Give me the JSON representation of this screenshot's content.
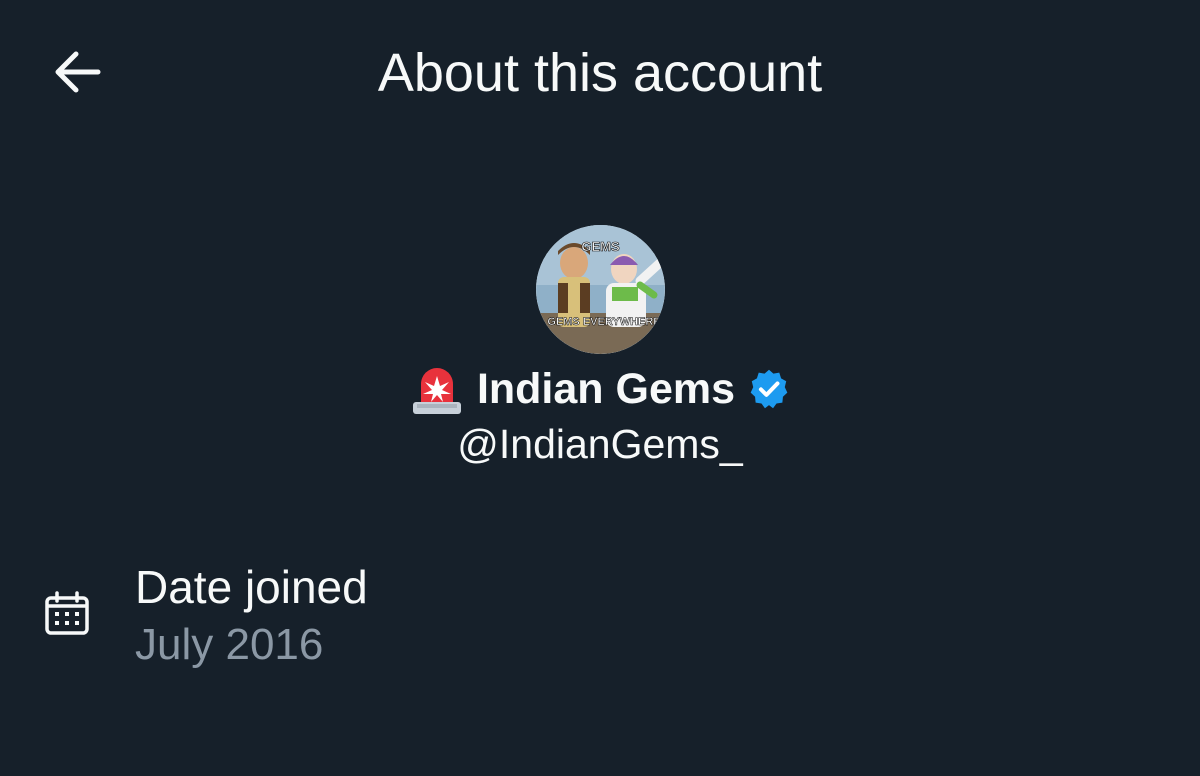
{
  "header": {
    "title": "About this account",
    "back_icon": "arrow-left-icon"
  },
  "profile": {
    "avatar_text_top": "GEMS",
    "avatar_text_bottom": "GEMS EVERYWHERE",
    "display_name": "Indian Gems",
    "prefix_icon": "police-siren-icon",
    "verified_icon": "verified-badge-icon",
    "handle": "@IndianGems_"
  },
  "details": {
    "date_joined_label": "Date joined",
    "date_joined_value": "July 2016",
    "date_icon": "calendar-icon"
  },
  "colors": {
    "background": "#16202a",
    "primary_text": "#f7f9f9",
    "secondary_text": "#8b98a5",
    "verified": "#1d9bf0"
  }
}
